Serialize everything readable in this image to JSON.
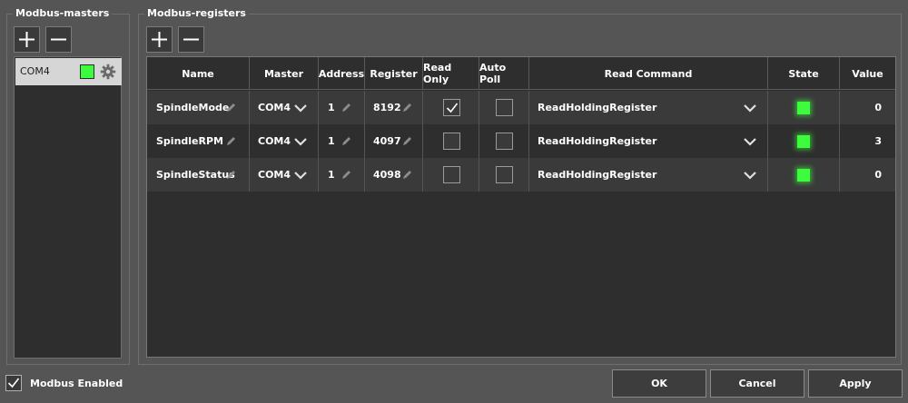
{
  "masters": {
    "title": "Modbus-masters",
    "add_icon": "plus-icon",
    "remove_icon": "minus-icon",
    "items": [
      {
        "label": "COM4",
        "status_color": "#3dfb3d",
        "settings_icon": "gear-icon"
      }
    ]
  },
  "registers": {
    "title": "Modbus-registers",
    "add_icon": "plus-icon",
    "remove_icon": "minus-icon",
    "columns": [
      "Name",
      "Master",
      "Address",
      "Register",
      "Read Only",
      "Auto Poll",
      "Read Command",
      "State",
      "Value"
    ],
    "rows": [
      {
        "name": "SpindleMode",
        "master": "COM4",
        "address": "1",
        "register": "8192",
        "read_only": true,
        "auto_poll": false,
        "read_command": "ReadHoldingRegister",
        "state_color": "#3dfb3d",
        "value": "0"
      },
      {
        "name": "SpindleRPM",
        "master": "COM4",
        "address": "1",
        "register": "4097",
        "read_only": false,
        "auto_poll": false,
        "read_command": "ReadHoldingRegister",
        "state_color": "#3dfb3d",
        "value": "3"
      },
      {
        "name": "SpindleStatus",
        "master": "COM4",
        "address": "1",
        "register": "4098",
        "read_only": false,
        "auto_poll": false,
        "read_command": "ReadHoldingRegister",
        "state_color": "#3dfb3d",
        "value": "0"
      }
    ]
  },
  "footer": {
    "enabled_label": "Modbus Enabled",
    "enabled_checked": true,
    "ok_label": "OK",
    "cancel_label": "Cancel",
    "apply_label": "Apply"
  },
  "colors": {
    "background": "#555555",
    "panel": "#2e2e2e",
    "row_alt": "#3a3a3a",
    "led_green": "#3dfb3d"
  }
}
